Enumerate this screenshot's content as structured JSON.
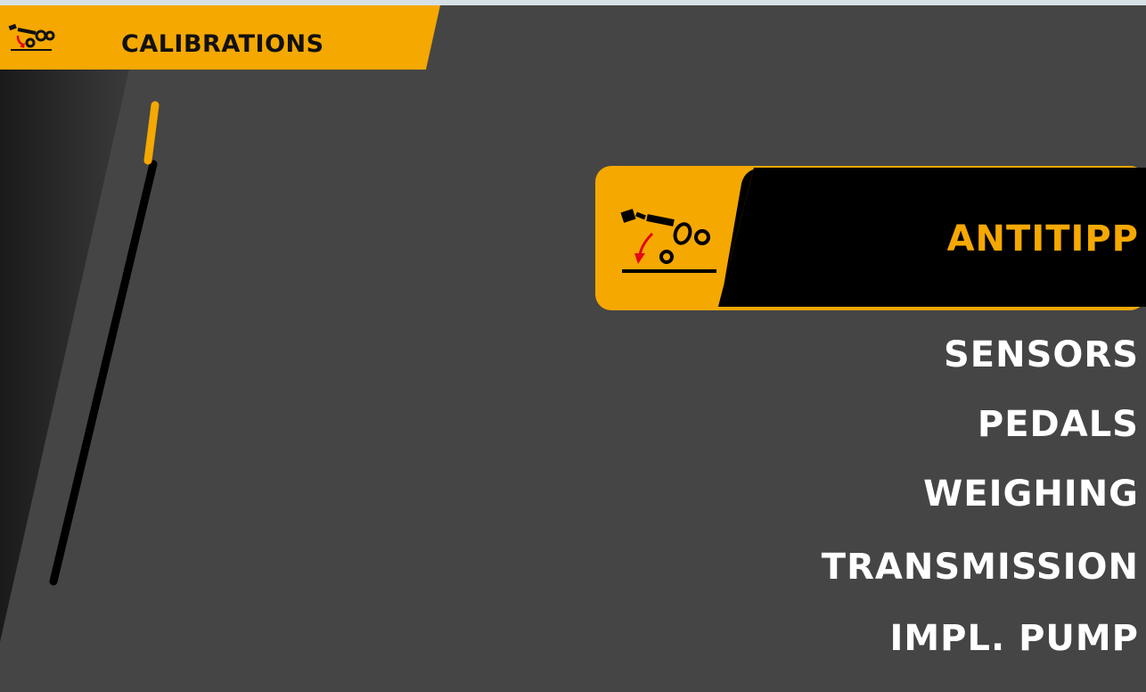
{
  "header": {
    "title": "CALIBRATIONS",
    "icon": "telehandler-calibration-icon"
  },
  "menu": {
    "selected": {
      "label": "ANTITIPP",
      "icon": "antitipp-icon"
    },
    "items": [
      {
        "label": "SENSORS"
      },
      {
        "label": "PEDALS"
      },
      {
        "label": "WEIGHING"
      },
      {
        "label": "TRANSMISSION"
      },
      {
        "label": "IMPL. PUMP"
      }
    ]
  },
  "scrollbar": {
    "position_fraction": 0.0
  },
  "colors": {
    "accent": "#F5A800",
    "background": "#454545",
    "selected_background": "#000000",
    "text": "#FFFFFF",
    "alert_arrow": "#E30613"
  }
}
